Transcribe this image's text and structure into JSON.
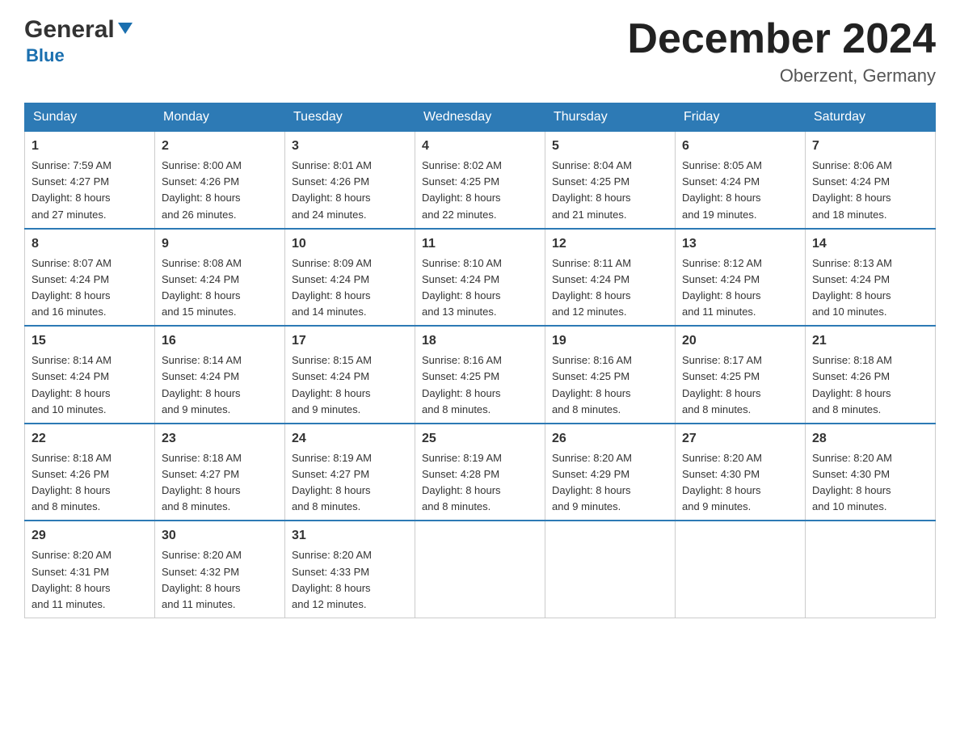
{
  "header": {
    "logo_general": "General",
    "logo_blue": "Blue",
    "month_title": "December 2024",
    "location": "Oberzent, Germany"
  },
  "days_of_week": [
    "Sunday",
    "Monday",
    "Tuesday",
    "Wednesday",
    "Thursday",
    "Friday",
    "Saturday"
  ],
  "weeks": [
    [
      {
        "day": "1",
        "sunrise": "7:59 AM",
        "sunset": "4:27 PM",
        "daylight": "8 hours and 27 minutes."
      },
      {
        "day": "2",
        "sunrise": "8:00 AM",
        "sunset": "4:26 PM",
        "daylight": "8 hours and 26 minutes."
      },
      {
        "day": "3",
        "sunrise": "8:01 AM",
        "sunset": "4:26 PM",
        "daylight": "8 hours and 24 minutes."
      },
      {
        "day": "4",
        "sunrise": "8:02 AM",
        "sunset": "4:25 PM",
        "daylight": "8 hours and 22 minutes."
      },
      {
        "day": "5",
        "sunrise": "8:04 AM",
        "sunset": "4:25 PM",
        "daylight": "8 hours and 21 minutes."
      },
      {
        "day": "6",
        "sunrise": "8:05 AM",
        "sunset": "4:24 PM",
        "daylight": "8 hours and 19 minutes."
      },
      {
        "day": "7",
        "sunrise": "8:06 AM",
        "sunset": "4:24 PM",
        "daylight": "8 hours and 18 minutes."
      }
    ],
    [
      {
        "day": "8",
        "sunrise": "8:07 AM",
        "sunset": "4:24 PM",
        "daylight": "8 hours and 16 minutes."
      },
      {
        "day": "9",
        "sunrise": "8:08 AM",
        "sunset": "4:24 PM",
        "daylight": "8 hours and 15 minutes."
      },
      {
        "day": "10",
        "sunrise": "8:09 AM",
        "sunset": "4:24 PM",
        "daylight": "8 hours and 14 minutes."
      },
      {
        "day": "11",
        "sunrise": "8:10 AM",
        "sunset": "4:24 PM",
        "daylight": "8 hours and 13 minutes."
      },
      {
        "day": "12",
        "sunrise": "8:11 AM",
        "sunset": "4:24 PM",
        "daylight": "8 hours and 12 minutes."
      },
      {
        "day": "13",
        "sunrise": "8:12 AM",
        "sunset": "4:24 PM",
        "daylight": "8 hours and 11 minutes."
      },
      {
        "day": "14",
        "sunrise": "8:13 AM",
        "sunset": "4:24 PM",
        "daylight": "8 hours and 10 minutes."
      }
    ],
    [
      {
        "day": "15",
        "sunrise": "8:14 AM",
        "sunset": "4:24 PM",
        "daylight": "8 hours and 10 minutes."
      },
      {
        "day": "16",
        "sunrise": "8:14 AM",
        "sunset": "4:24 PM",
        "daylight": "8 hours and 9 minutes."
      },
      {
        "day": "17",
        "sunrise": "8:15 AM",
        "sunset": "4:24 PM",
        "daylight": "8 hours and 9 minutes."
      },
      {
        "day": "18",
        "sunrise": "8:16 AM",
        "sunset": "4:25 PM",
        "daylight": "8 hours and 8 minutes."
      },
      {
        "day": "19",
        "sunrise": "8:16 AM",
        "sunset": "4:25 PM",
        "daylight": "8 hours and 8 minutes."
      },
      {
        "day": "20",
        "sunrise": "8:17 AM",
        "sunset": "4:25 PM",
        "daylight": "8 hours and 8 minutes."
      },
      {
        "day": "21",
        "sunrise": "8:18 AM",
        "sunset": "4:26 PM",
        "daylight": "8 hours and 8 minutes."
      }
    ],
    [
      {
        "day": "22",
        "sunrise": "8:18 AM",
        "sunset": "4:26 PM",
        "daylight": "8 hours and 8 minutes."
      },
      {
        "day": "23",
        "sunrise": "8:18 AM",
        "sunset": "4:27 PM",
        "daylight": "8 hours and 8 minutes."
      },
      {
        "day": "24",
        "sunrise": "8:19 AM",
        "sunset": "4:27 PM",
        "daylight": "8 hours and 8 minutes."
      },
      {
        "day": "25",
        "sunrise": "8:19 AM",
        "sunset": "4:28 PM",
        "daylight": "8 hours and 8 minutes."
      },
      {
        "day": "26",
        "sunrise": "8:20 AM",
        "sunset": "4:29 PM",
        "daylight": "8 hours and 9 minutes."
      },
      {
        "day": "27",
        "sunrise": "8:20 AM",
        "sunset": "4:30 PM",
        "daylight": "8 hours and 9 minutes."
      },
      {
        "day": "28",
        "sunrise": "8:20 AM",
        "sunset": "4:30 PM",
        "daylight": "8 hours and 10 minutes."
      }
    ],
    [
      {
        "day": "29",
        "sunrise": "8:20 AM",
        "sunset": "4:31 PM",
        "daylight": "8 hours and 11 minutes."
      },
      {
        "day": "30",
        "sunrise": "8:20 AM",
        "sunset": "4:32 PM",
        "daylight": "8 hours and 11 minutes."
      },
      {
        "day": "31",
        "sunrise": "8:20 AM",
        "sunset": "4:33 PM",
        "daylight": "8 hours and 12 minutes."
      },
      null,
      null,
      null,
      null
    ]
  ],
  "labels": {
    "sunrise": "Sunrise:",
    "sunset": "Sunset:",
    "daylight": "Daylight:"
  }
}
